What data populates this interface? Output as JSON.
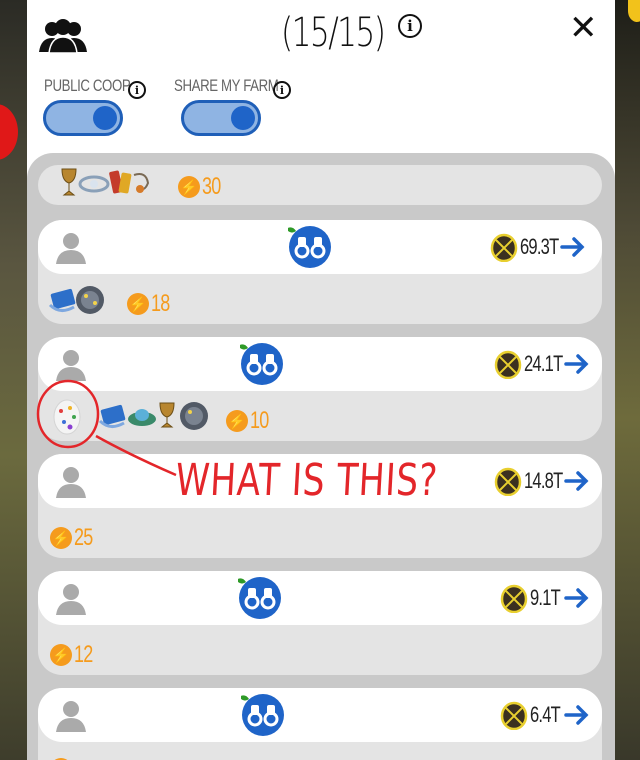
{
  "header": {
    "member_count": "(15/15)",
    "public_coop_label": "PUBLIC COOP",
    "share_farm_label": "SHARE MY FARM",
    "public_coop_on": true,
    "share_farm_on": true
  },
  "colors": {
    "toggle_blue": "#1f64c8",
    "token_orange": "#f59b1d",
    "annotation_red": "#e3262a"
  },
  "members": [
    {
      "eggs": "",
      "tokens": "30",
      "artifacts": [
        "trophy",
        "gusset",
        "ring",
        "book",
        "necklace"
      ]
    },
    {
      "eggs": "69.3T",
      "tokens": "18",
      "artifacts": [
        "tachyon-deflector",
        "cube"
      ]
    },
    {
      "eggs": "24.1T",
      "tokens": "10",
      "artifacts": [
        "easter-egg",
        "tachyon-deflector",
        "ship",
        "trophy",
        "cube"
      ]
    },
    {
      "eggs": "14.8T",
      "tokens": "25",
      "artifacts": []
    },
    {
      "eggs": "9.1T",
      "tokens": "12",
      "artifacts": []
    },
    {
      "eggs": "6.4T",
      "tokens": "",
      "artifacts": []
    }
  ],
  "annotation": {
    "text": "WHAT IS THIS?"
  }
}
